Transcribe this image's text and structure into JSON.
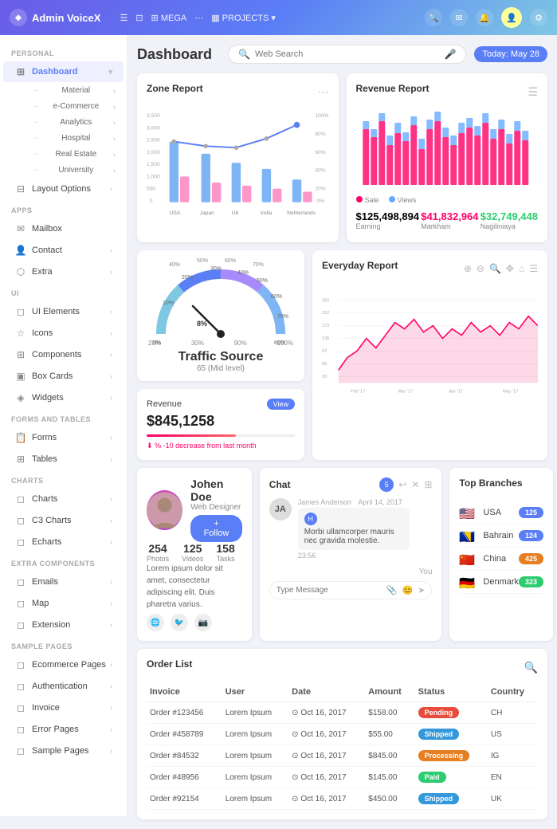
{
  "topnav": {
    "logo": "Admin VoiceX",
    "menu_items": [
      "MEGA",
      "PROJECTS"
    ],
    "date_label": "Today: May 28"
  },
  "sidebar": {
    "personal_label": "PERSONAL",
    "apps_label": "APPS",
    "ui_label": "UI",
    "forms_label": "FORMS AND TABLES",
    "charts_label": "CHARTS",
    "extra_label": "EXTRA COMPONENTS",
    "sample_label": "SAMPLE PAGES",
    "items": [
      {
        "label": "Dashboard",
        "icon": "⊞",
        "active": true
      },
      {
        "label": "Material",
        "icon": "◈"
      },
      {
        "label": "e-Commerce",
        "icon": "·"
      },
      {
        "label": "Analytics",
        "icon": "·"
      },
      {
        "label": "Hospital",
        "icon": "·"
      },
      {
        "label": "Real Estate",
        "icon": "·"
      },
      {
        "label": "University",
        "icon": "·"
      },
      {
        "label": "Layout Options",
        "icon": "⊟"
      },
      {
        "label": "Mailbox",
        "icon": "✉"
      },
      {
        "label": "Contact",
        "icon": "👤"
      },
      {
        "label": "Extra",
        "icon": "⬡"
      },
      {
        "label": "UI Elements",
        "icon": "◻"
      },
      {
        "label": "Icons",
        "icon": "☆"
      },
      {
        "label": "Components",
        "icon": "⊞"
      },
      {
        "label": "Box Cards",
        "icon": "▣"
      },
      {
        "label": "Widgets",
        "icon": "◈"
      },
      {
        "label": "Forms",
        "icon": "📋"
      },
      {
        "label": "Tables",
        "icon": "⊞"
      },
      {
        "label": "Charts",
        "icon": "◻"
      },
      {
        "label": "C3 Charts",
        "icon": "◻"
      },
      {
        "label": "Echarts",
        "icon": "◻"
      },
      {
        "label": "Emails",
        "icon": "◻"
      },
      {
        "label": "Map",
        "icon": "◻"
      },
      {
        "label": "Extension",
        "icon": "◻"
      },
      {
        "label": "Ecommerce Pages",
        "icon": "◻"
      },
      {
        "label": "Authentication",
        "icon": "◻"
      },
      {
        "label": "Invoice",
        "icon": "◻"
      },
      {
        "label": "Error Pages",
        "icon": "◻"
      },
      {
        "label": "Sample Pages",
        "icon": "◻"
      }
    ]
  },
  "dashboard": {
    "title": "Dashboard",
    "search_placeholder": "Web Search",
    "date_label": "Today: May 28"
  },
  "zone_report": {
    "title": "Zone Report",
    "y_left": [
      "3,500",
      "3,000",
      "2,500",
      "2,000",
      "1,500",
      "1,000",
      "500",
      "0"
    ],
    "y_right": [
      "100%",
      "80%",
      "60%",
      "40%",
      "20%",
      "0%"
    ],
    "x_labels": [
      "USA",
      "Japan",
      "UK",
      "India",
      "Netherlands"
    ]
  },
  "revenue_report": {
    "title": "Revenue Report",
    "legend": [
      "Sale",
      "Views"
    ],
    "stats": [
      {
        "value": "$125,498,894",
        "label": "Earning"
      },
      {
        "value": "$41,832,964",
        "label": "Markham"
      },
      {
        "value": "$32,749,448",
        "label": "Nagiliniaya"
      }
    ]
  },
  "traffic_source": {
    "title": "Traffic Source",
    "subtitle": "65 (Mid level)",
    "gauge_labels": [
      "0%",
      "10%",
      "20%",
      "30%",
      "40%",
      "50%",
      "60%",
      "70%",
      "80%",
      "90%",
      "100%"
    ],
    "arc_labels": [
      "8%"
    ]
  },
  "revenue_mini": {
    "title": "Revenue",
    "badge": "View",
    "value": "$845,1258",
    "note": "% -10 decrease from last month"
  },
  "everyday_report": {
    "title": "Everyday Report",
    "y_labels": [
      "260",
      "212",
      "173",
      "135",
      "97",
      "58",
      "20"
    ],
    "x_labels": [
      "Feb '17",
      "Mar '17",
      "Apr '17",
      "May '17"
    ]
  },
  "profile": {
    "name": "Johen Doe",
    "role": "Web Designer",
    "follow_label": "+ Follow",
    "stats": [
      {
        "value": "254",
        "label": "Photos"
      },
      {
        "value": "125",
        "label": "Videos"
      },
      {
        "value": "158",
        "label": "Tasks"
      }
    ],
    "description": "Lorem ipsum dolor sit amet, consectetur adipiscing elit. Duis pharetra varius."
  },
  "chat": {
    "title": "Chat",
    "badge": "5",
    "sender": "James Anderson",
    "date": "April 14, 2017",
    "avatar_letter": "H",
    "message": "Morbi ullamcorper mauris nec gravida molestie.",
    "time": "23:56",
    "you_label": "You",
    "input_placeholder": "Type Message"
  },
  "top_branches": {
    "title": "Top Branches",
    "items": [
      {
        "flag": "🇺🇸",
        "name": "USA",
        "count": "125",
        "badge_type": "blue"
      },
      {
        "flag": "🇧🇦",
        "name": "Bahrain",
        "count": "124",
        "badge_type": "blue"
      },
      {
        "flag": "🇨🇳",
        "name": "China",
        "count": "425",
        "badge_type": "orange"
      },
      {
        "flag": "🇩🇪",
        "name": "Denmark",
        "count": "323",
        "badge_type": "green"
      }
    ]
  },
  "order_list": {
    "title": "Order List",
    "columns": [
      "Invoice",
      "User",
      "Date",
      "Amount",
      "Status",
      "Country"
    ],
    "rows": [
      {
        "invoice": "Order #123456",
        "user": "Lorem Ipsum",
        "date": "⊙ Oct 16, 2017",
        "amount": "$158.00",
        "status": "Pending",
        "status_type": "pending",
        "country": "CH"
      },
      {
        "invoice": "Order #458789",
        "user": "Lorem Ipsum",
        "date": "⊙ Oct 16, 2017",
        "amount": "$55.00",
        "status": "Shipped",
        "status_type": "shipped",
        "country": "US"
      },
      {
        "invoice": "Order #84532",
        "user": "Lorem Ipsum",
        "date": "⊙ Oct 16, 2017",
        "amount": "$845.00",
        "status": "Processing",
        "status_type": "processing",
        "country": "IG"
      },
      {
        "invoice": "Order #48956",
        "user": "Lorem Ipsum",
        "date": "⊙ Oct 16, 2017",
        "amount": "$145.00",
        "status": "Paid",
        "status_type": "paid",
        "country": "EN"
      },
      {
        "invoice": "Order #92154",
        "user": "Lorem Ipsum",
        "date": "⊙ Oct 16, 2017",
        "amount": "$450.00",
        "status": "Shipped",
        "status_type": "shipped",
        "country": "UK"
      }
    ]
  }
}
